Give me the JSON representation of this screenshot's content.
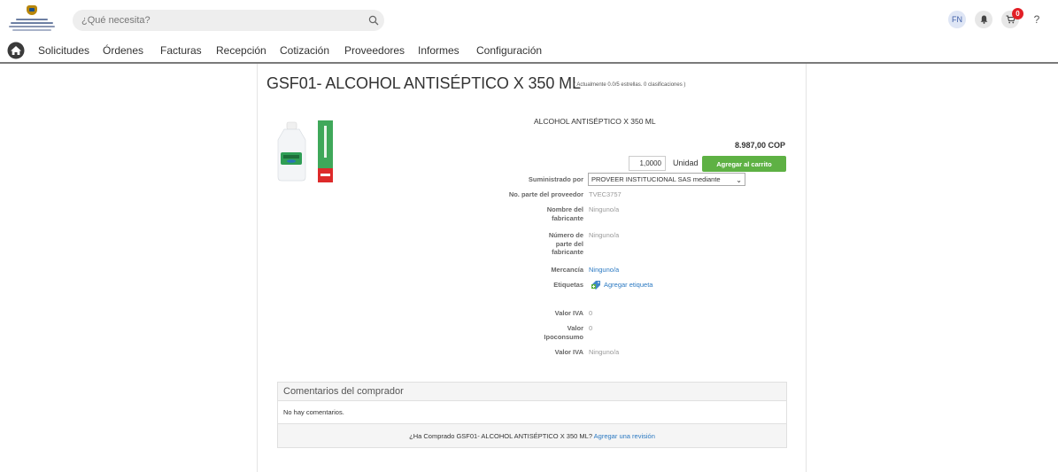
{
  "header": {
    "search_placeholder": "¿Qué necesita?",
    "user_initials": "FN",
    "cart_count": "0",
    "help_label": "?"
  },
  "nav": {
    "items": [
      "Solicitudes",
      "Órdenes",
      "Facturas",
      "Recepción",
      "Cotización",
      "Proveedores",
      "Informes",
      "Configuración"
    ]
  },
  "product": {
    "title": "GSF01- ALCOHOL ANTISÉPTICO X 350 ML",
    "rating_text": "( Actualmente 0.0/5 estrellas. 0 clasificaciones )",
    "name": "ALCOHOL ANTISÉPTICO X 350 ML",
    "price": "8.987,00 COP",
    "quantity": "1,0000",
    "unit": "Unidad",
    "add_to_cart_label": "Agregar al carrito",
    "supplied_by_label": "Suministrado por",
    "supplier_value": "PROVEER INSTITUCIONAL SAS mediante",
    "supplier_part_label": "No. parte del proveedor",
    "supplier_part_value": "TVEC3757",
    "manufacturer_label": "Nombre del fabricante",
    "manufacturer_value": "Ninguno/a",
    "manufacturer_part_label": "Número de parte del fabricante",
    "manufacturer_part_value": "Ninguno/a",
    "commodity_label": "Mercancía",
    "commodity_value": "Ninguno/a",
    "tags_label": "Etiquetas",
    "add_tag_label": "Agregar etiqueta",
    "iva_label": "Valor IVA",
    "iva_value": "0",
    "ipoconsumo_label": "Valor Ipoconsumo",
    "ipoconsumo_value": "0",
    "iva2_label": "Valor IVA",
    "iva2_value": "Ninguno/a"
  },
  "comments": {
    "heading": "Comentarios del comprador",
    "empty_text": "No hay comentarios.",
    "prompt_text": "¿Ha Comprado GSF01- ALCOHOL ANTISÉPTICO X 350 ML?",
    "review_link": "Agregar una revisión"
  },
  "colors": {
    "accent_green": "#5eb144",
    "link_blue": "#2b79c2",
    "badge_red": "#e21f26"
  }
}
